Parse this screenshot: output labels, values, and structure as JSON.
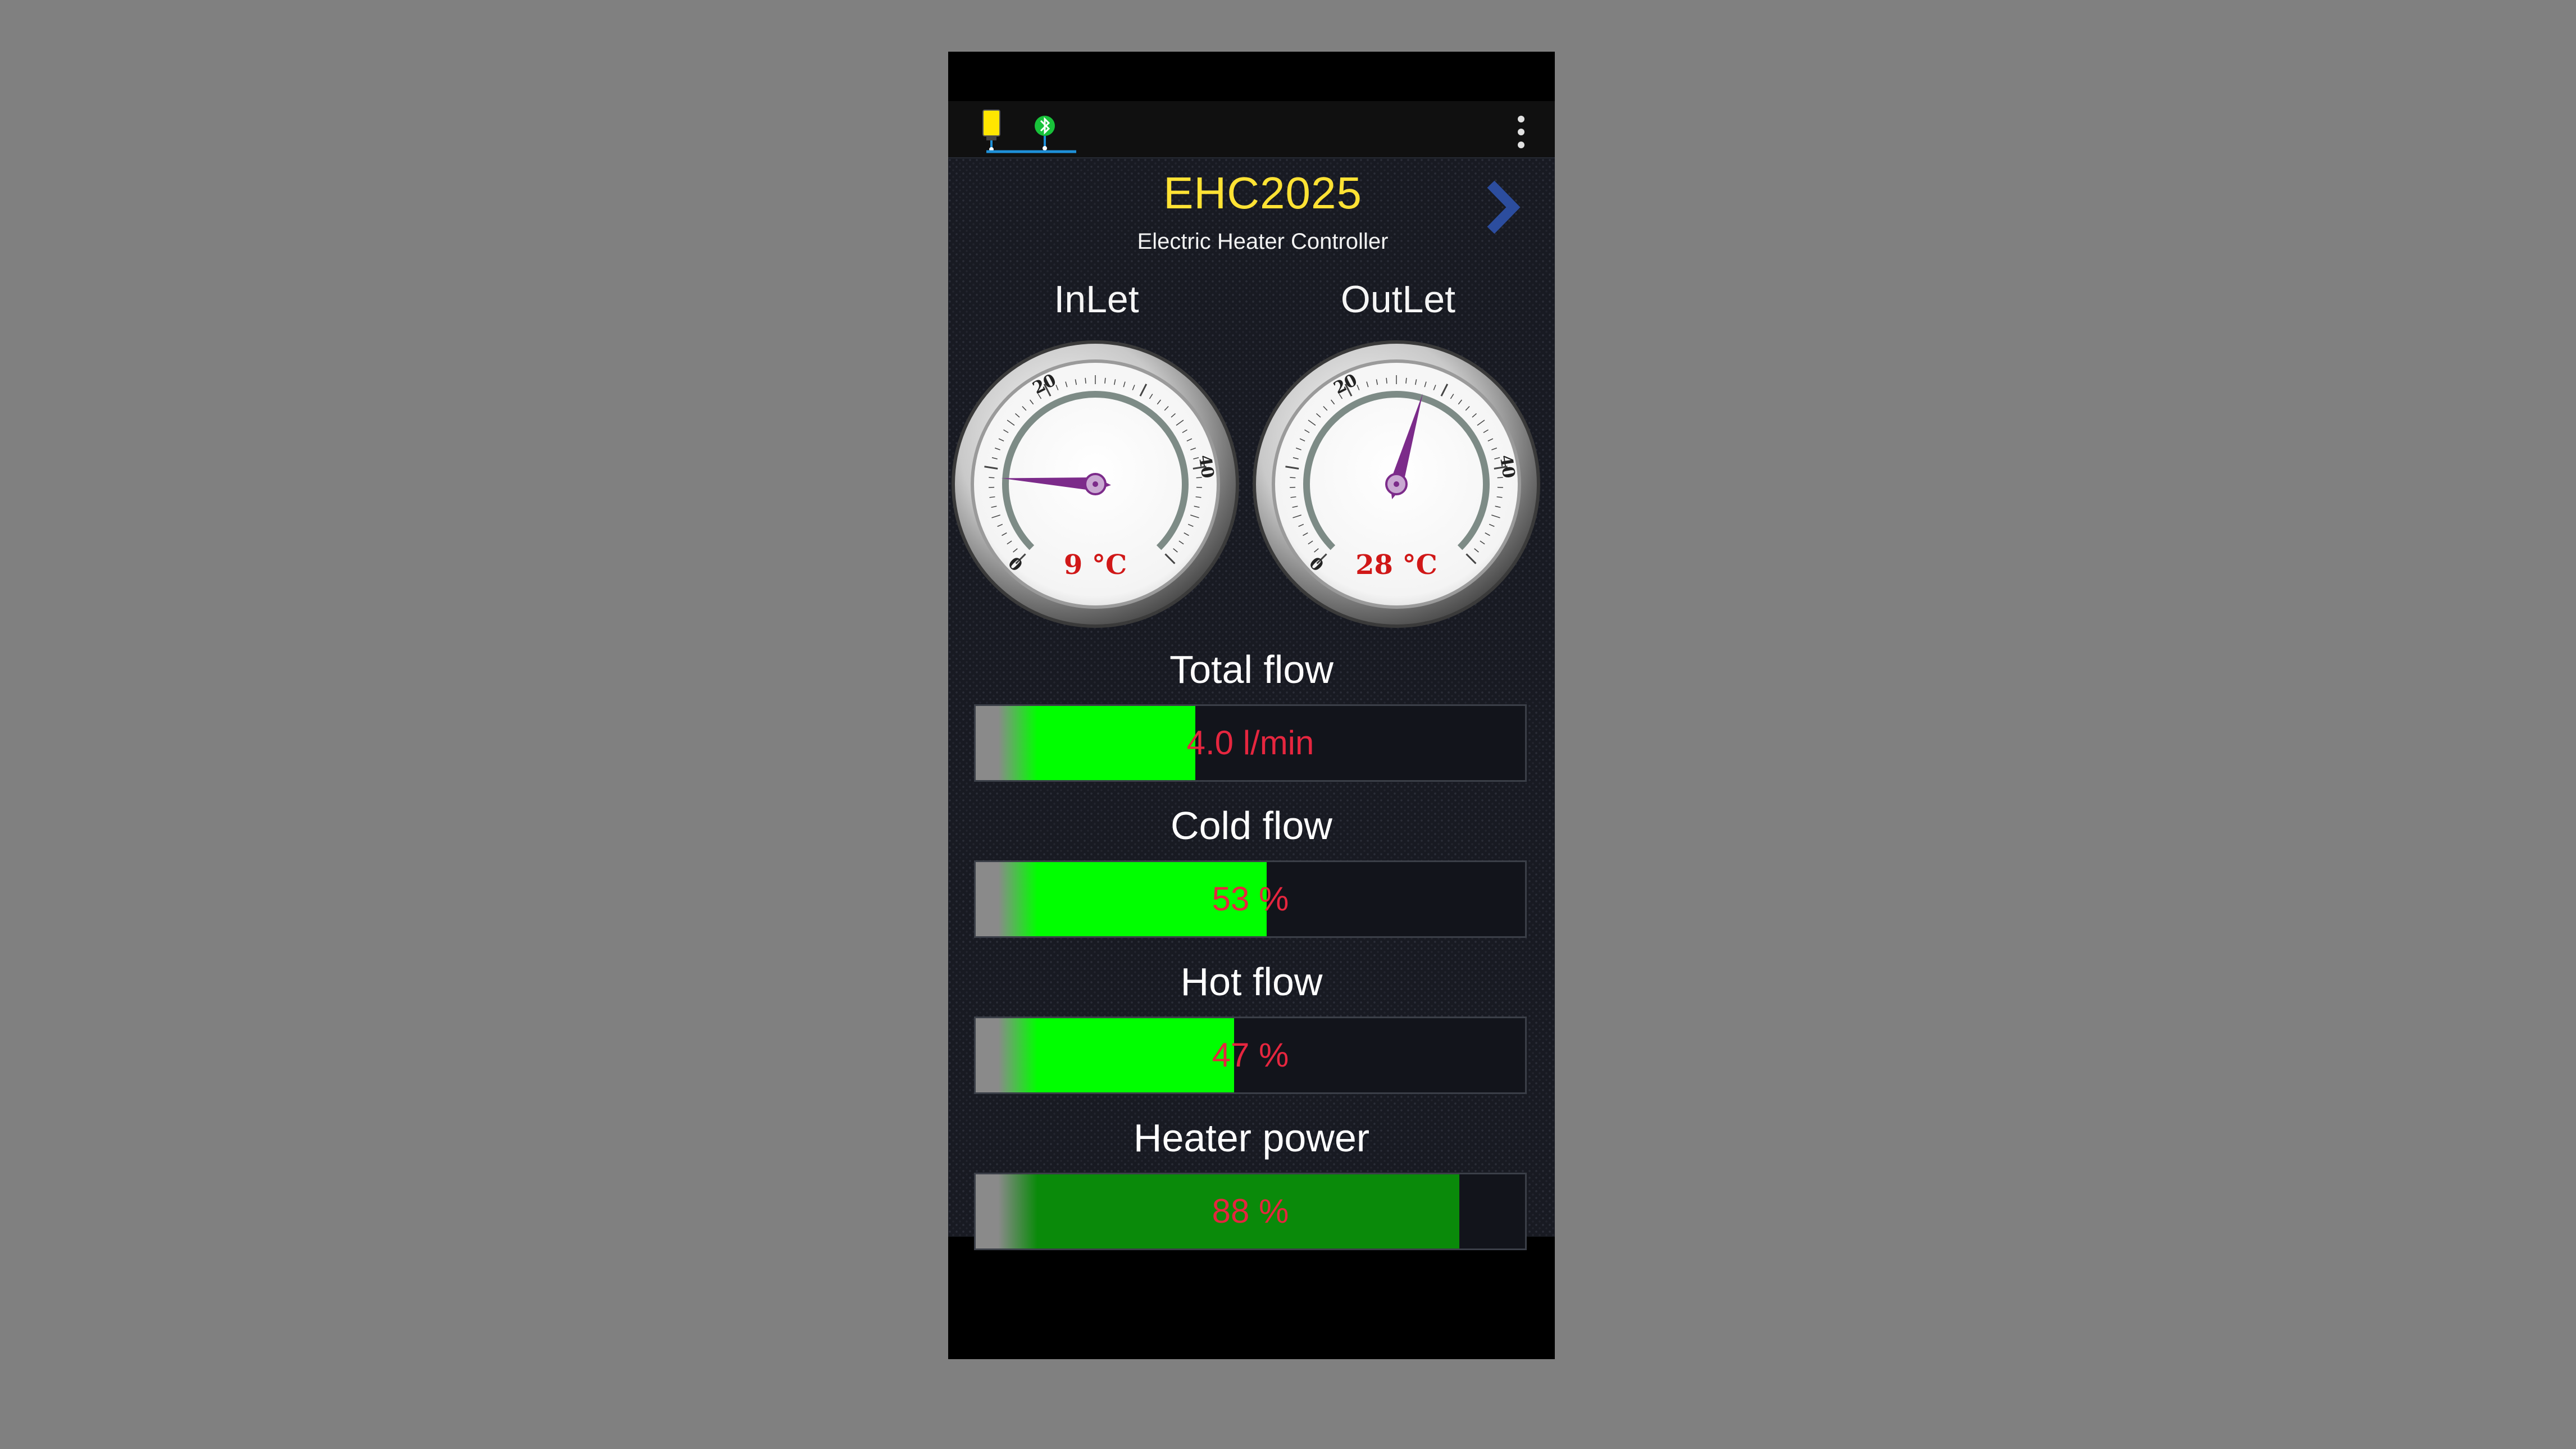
{
  "app": {
    "title": "EHC2025",
    "subtitle": "Electric Heater Controller"
  },
  "status_bar": {
    "icons": [
      "device-battery-icon",
      "bluetooth-icon"
    ],
    "menu_icon": "more-vert-icon"
  },
  "navigation": {
    "next_icon": "chevron-right-icon"
  },
  "gauges": {
    "scale_ticks": [
      "0",
      "20",
      "40"
    ],
    "scale_min": 0,
    "scale_max": 50,
    "inlet": {
      "label": "InLet",
      "value": 9,
      "readout": "9 °C"
    },
    "outlet": {
      "label": "OutLet",
      "value": 28,
      "readout": "28 °C"
    }
  },
  "flows": {
    "total": {
      "label": "Total flow",
      "readout": "4.0 l/min",
      "fill_fraction": 0.4
    },
    "cold": {
      "label": "Cold flow",
      "readout": "53 %",
      "fill_fraction": 0.53
    },
    "hot": {
      "label": "Hot flow",
      "readout": "47 %",
      "fill_fraction": 0.47
    },
    "heater": {
      "label": "Heater power",
      "readout": "88 %",
      "fill_fraction": 0.88
    }
  },
  "colors": {
    "title": "#ffe234",
    "flow_fill": "#00ff00",
    "power_fill": "#0a8a0a",
    "readout_red": "#e6263f",
    "needle": "#7c2b8a",
    "accent_blue": "#1e90d8",
    "nav_arrow": "#2c4d9e"
  }
}
